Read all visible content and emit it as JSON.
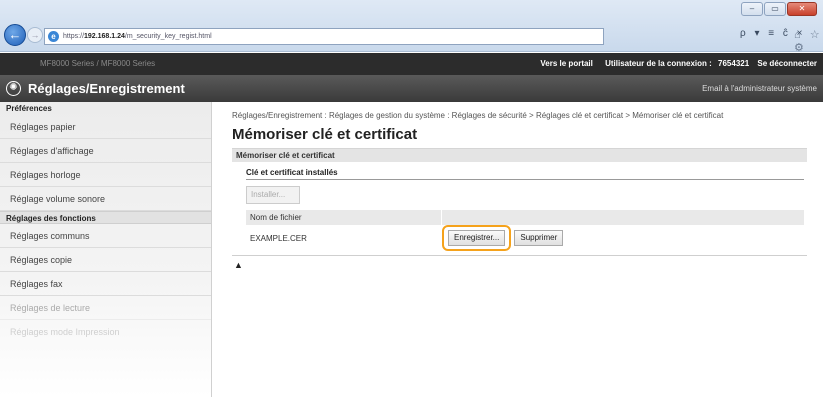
{
  "browser": {
    "address_prefix": "https://",
    "address_host": "192.168.1.24",
    "address_path": "/m_security_key_regist.html",
    "address_tools": "ρ ▾ ≡ ĉ ×",
    "fav_tools": "⌂ ☆ ⚙",
    "win_min": "–",
    "win_max": "▭",
    "win_close": "✕"
  },
  "topbar": {
    "device": "MF8000 Series / MF8000 Series",
    "portal_link": "Vers le portail",
    "user_label": "Utilisateur de la connexion :",
    "user_id": "7654321",
    "logout_link": "Se déconnecter"
  },
  "titlebar": {
    "title": "Réglages/Enregistrement",
    "mail_link": "Email à l'administrateur système"
  },
  "sidebar": {
    "section1": "Préférences",
    "items1": [
      "Réglages papier",
      "Réglages d'affichage",
      "Réglages horloge",
      "Réglage volume sonore"
    ],
    "section2": "Réglages des fonctions",
    "items2": [
      "Réglages communs",
      "Réglages copie",
      "Réglages fax",
      "Réglages de lecture",
      "Réglages mode Impression"
    ]
  },
  "main": {
    "breadcrumb": "Réglages/Enregistrement : Réglages de gestion du système : Réglages de sécurité > Réglages clé et certificat > Mémoriser clé et certificat",
    "page_title": "Mémoriser clé et certificat",
    "section_title": "Mémoriser clé et certificat",
    "installed_title": "Clé et certificat installés",
    "install_button": "Installer...",
    "column_filename": "Nom de fichier",
    "rows": [
      {
        "filename": "EXAMPLE.CER",
        "register_button": "Enregistrer...",
        "delete_button": "Supprimer"
      }
    ],
    "top_link": "▲"
  }
}
